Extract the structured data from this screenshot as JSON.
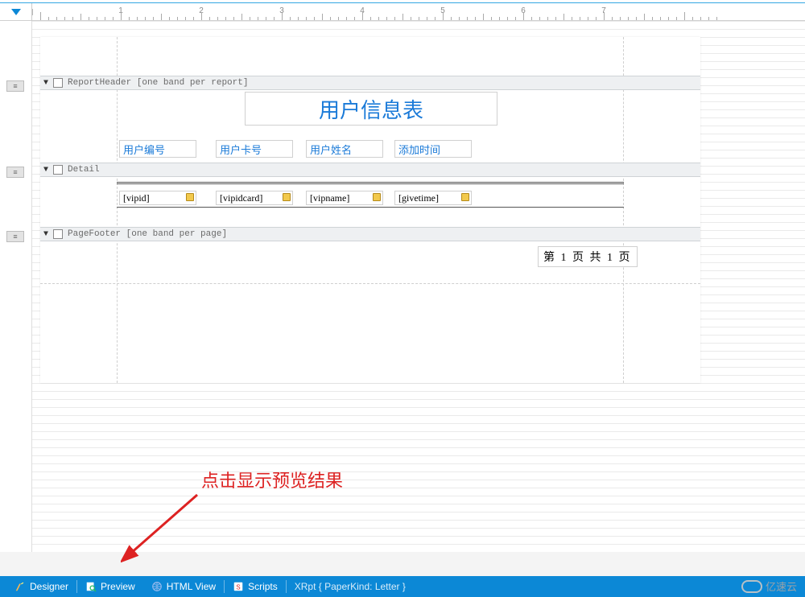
{
  "ruler": {
    "labels": [
      "1",
      "2",
      "3",
      "4",
      "5",
      "6",
      "7"
    ]
  },
  "bands": {
    "reportHeader": {
      "label": "ReportHeader [one band per report]"
    },
    "detail": {
      "label": "Detail"
    },
    "pageFooter": {
      "label": "PageFooter [one band per page]"
    }
  },
  "header": {
    "title": "用户信息表",
    "columns": [
      "用户编号",
      "用户卡号",
      "用户姓名",
      "添加时间"
    ]
  },
  "detail": {
    "fields": [
      "[vipid]",
      "[vipidcard]",
      "[vipname]",
      "[givetime]"
    ]
  },
  "footer": {
    "text": "第 1 页 共 1 页"
  },
  "annotation": "点击显示预览结果",
  "statusbar": {
    "designer": "Designer",
    "preview": "Preview",
    "htmlview": "HTML View",
    "scripts": "Scripts",
    "info": "XRpt { PaperKind: Letter }"
  },
  "watermark": "亿速云"
}
